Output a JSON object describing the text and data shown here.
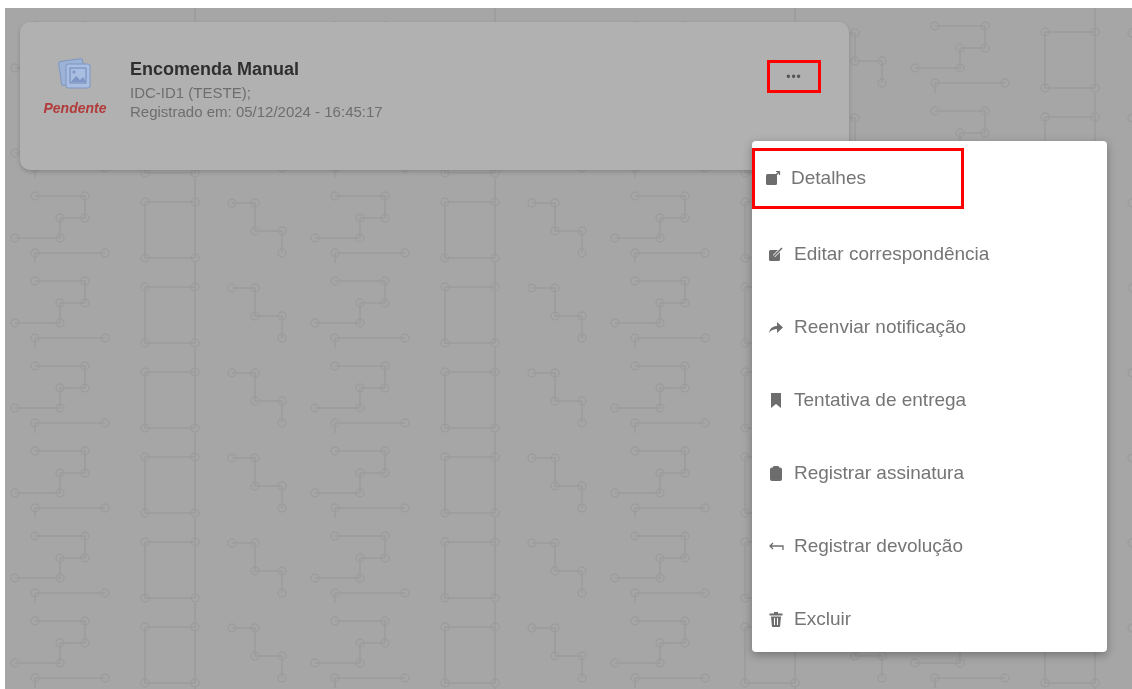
{
  "card": {
    "title": "Encomenda Manual",
    "lines": [
      "IDC-ID1 (TESTE);",
      "Registrado em: 05/12/2024 - 16:45:17"
    ],
    "status": "Pendente",
    "more_button": {
      "label": "•••",
      "highlighted": true
    }
  },
  "menu": {
    "items": [
      {
        "label": "Detalhes",
        "highlighted": true
      },
      {
        "label": "Editar correspondência",
        "highlighted": false
      },
      {
        "label": "Reenviar notificação",
        "highlighted": false
      },
      {
        "label": "Tentativa de entrega",
        "highlighted": false
      },
      {
        "label": "Registrar assinatura",
        "highlighted": false
      },
      {
        "label": "Registrar devolução",
        "highlighted": false
      },
      {
        "label": "Excluir",
        "highlighted": false
      }
    ]
  }
}
